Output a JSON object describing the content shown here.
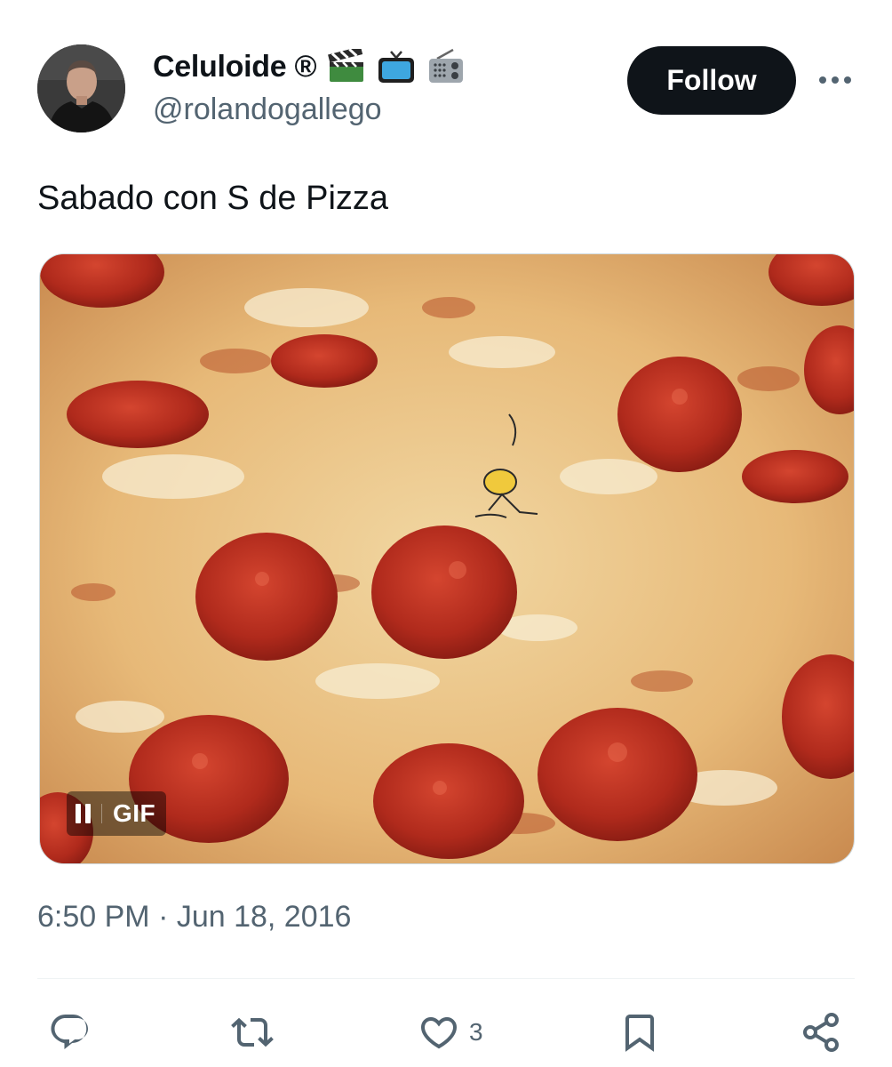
{
  "author": {
    "display_name": "Celuloide ®",
    "name_emojis": [
      "clapper-board-emoji",
      "television-emoji",
      "radio-emoji"
    ],
    "handle": "@rolandogallego"
  },
  "header": {
    "follow_label": "Follow",
    "more_icon": "more-horizontal-icon"
  },
  "tweet": {
    "text": "Sabado con S de Pizza",
    "timestamp": "6:50 PM · Jun 18, 2016"
  },
  "media": {
    "type": "GIF",
    "badge_label": "GIF",
    "control_icon": "pause-icon"
  },
  "actions": {
    "reply_icon": "reply-icon",
    "retweet_icon": "retweet-icon",
    "like_icon": "heart-icon",
    "like_count": "3",
    "bookmark_icon": "bookmark-icon",
    "share_icon": "share-icon"
  },
  "colors": {
    "text_primary": "#0f1419",
    "text_secondary": "#536471",
    "follow_bg": "#0f1419",
    "follow_text": "#ffffff",
    "divider": "#eff3f4"
  }
}
